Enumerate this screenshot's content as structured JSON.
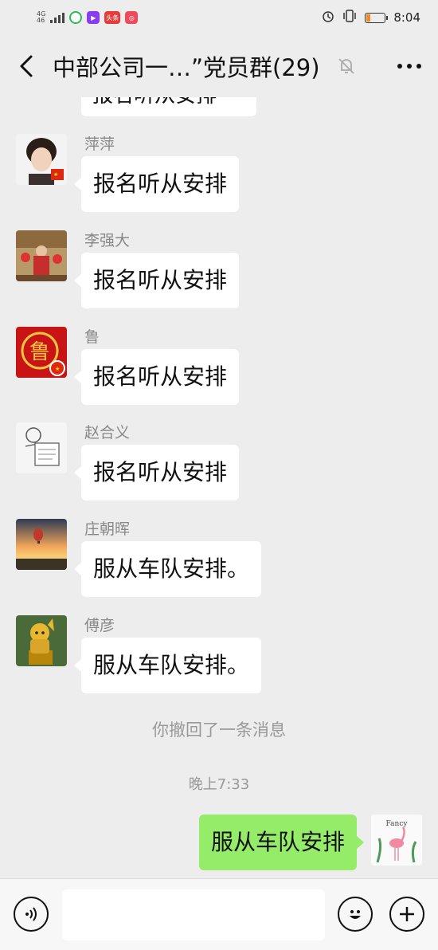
{
  "status_bar": {
    "network": [
      "4G",
      "46"
    ],
    "time": "8:04",
    "app_icons": [
      {
        "name": "wechat-moments-icon",
        "color": "#2dbb5a",
        "label": ""
      },
      {
        "name": "video-app-icon",
        "color": "#8a3cf0",
        "label": ""
      },
      {
        "name": "toutiao-icon",
        "color": "#e83a3a",
        "label": "头条"
      },
      {
        "name": "app-icon",
        "color": "#ef4a5b",
        "label": ""
      }
    ]
  },
  "header": {
    "title": "中部公司一…”党员群(29)"
  },
  "partial_message": {
    "text": "报名听从安排"
  },
  "messages": [
    {
      "sender": "萍萍",
      "text": "报名听从安排",
      "avatar_colors": [
        "#f3f3f3",
        "#3a2a22"
      ]
    },
    {
      "sender": "李强大",
      "text": "报名听从安排",
      "avatar_colors": [
        "#c62d2d",
        "#b89968"
      ]
    },
    {
      "sender": "鲁",
      "text": "报名听从安排",
      "avatar_colors": [
        "#c81414",
        "#f5c542"
      ]
    },
    {
      "sender": "赵合义",
      "text": "报名听从安排",
      "avatar_colors": [
        "#f5f5f5",
        "#666666"
      ]
    },
    {
      "sender": "庄朝晖",
      "text": "服从车队安排。",
      "avatar_colors": [
        "#f2a65a",
        "#2e3b55"
      ]
    },
    {
      "sender": "傅彦",
      "text": "服从车队安排。",
      "avatar_colors": [
        "#4a6a3a",
        "#d9a62a"
      ]
    }
  ],
  "system": {
    "recall_notice": "你撤回了一条消息",
    "timestamp": "晚上7:33"
  },
  "my_message": {
    "text": "服从车队安排"
  },
  "input": {
    "placeholder": "",
    "value": ""
  },
  "colors": {
    "background": "#ededed",
    "my_bubble": "#95ec69",
    "other_bubble": "#ffffff"
  }
}
